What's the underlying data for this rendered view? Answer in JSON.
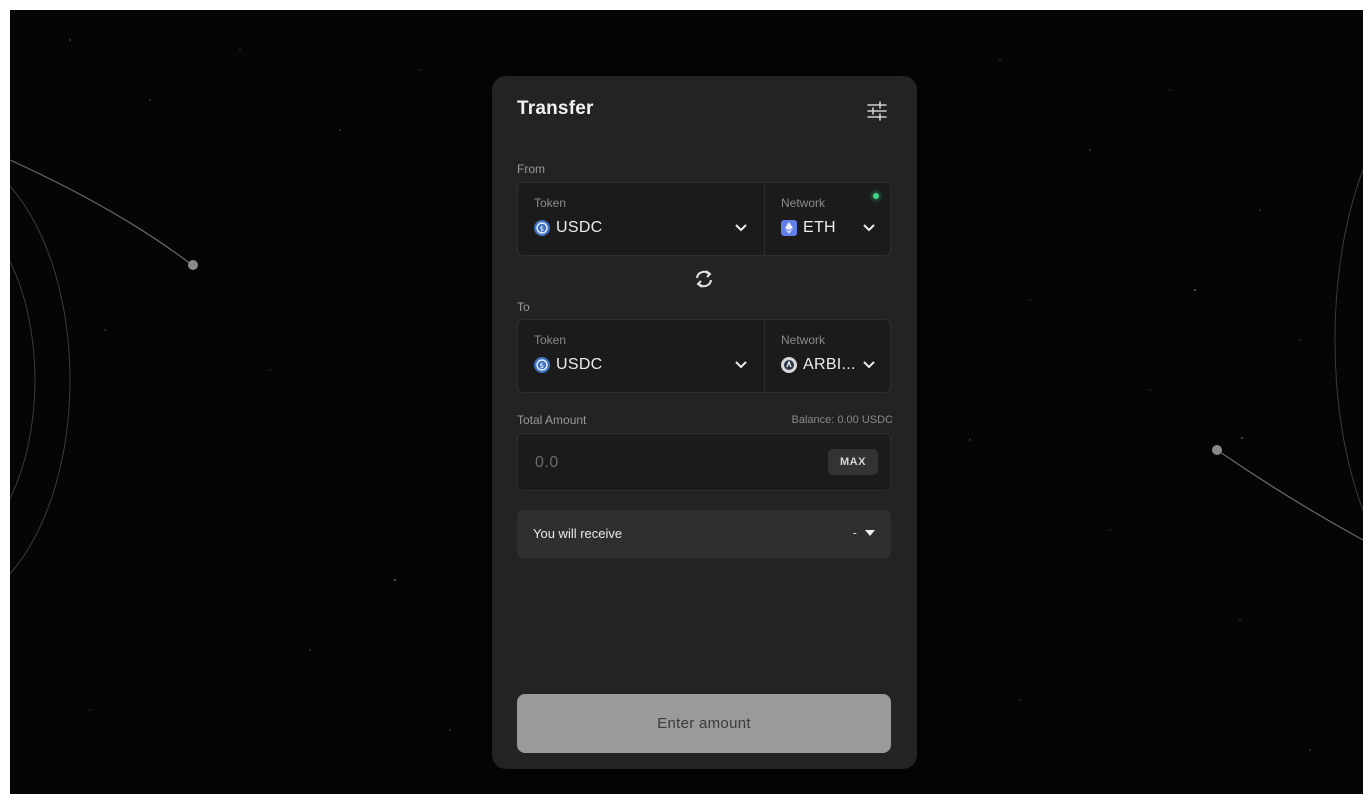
{
  "transfer": {
    "title": "Transfer",
    "from": {
      "section_label": "From",
      "token_label": "Token",
      "token_value": "USDC",
      "network_label": "Network",
      "network_value": "ETH"
    },
    "to": {
      "section_label": "To",
      "token_label": "Token",
      "token_value": "USDC",
      "network_label": "Network",
      "network_value": "ARBI..."
    },
    "amount": {
      "label": "Total Amount",
      "balance": "Balance: 0.00 USDC",
      "placeholder": "0.0",
      "max_label": "MAX"
    },
    "receive": {
      "label": "You will receive",
      "value": "-"
    },
    "submit_label": "Enter amount"
  },
  "icons": {
    "settings": "sliders-icon",
    "swap": "swap-arrows-icon",
    "usdc": "usdc-coin-icon",
    "eth": "eth-badge-icon",
    "arb": "arbitrum-badge-icon",
    "chevron": "chevron-down-icon",
    "caret": "caret-down-icon"
  },
  "colors": {
    "card": "#232323",
    "field": "#1b1b1b",
    "usdc": "#3e73c4",
    "eth": "#627eea",
    "status": "#44d18a",
    "button": "#9a9a9a"
  }
}
